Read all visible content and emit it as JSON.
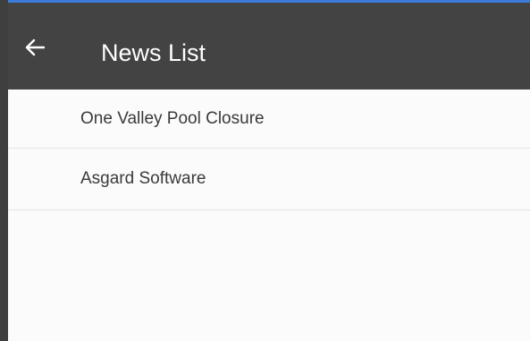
{
  "app_bar": {
    "title": "News List",
    "back_icon": "arrow-left-icon",
    "background_color": "#434343",
    "accent_color": "#3b7ad8"
  },
  "news": {
    "items": [
      {
        "label": "One Valley Pool Closure"
      },
      {
        "label": "Asgard Software"
      }
    ]
  }
}
